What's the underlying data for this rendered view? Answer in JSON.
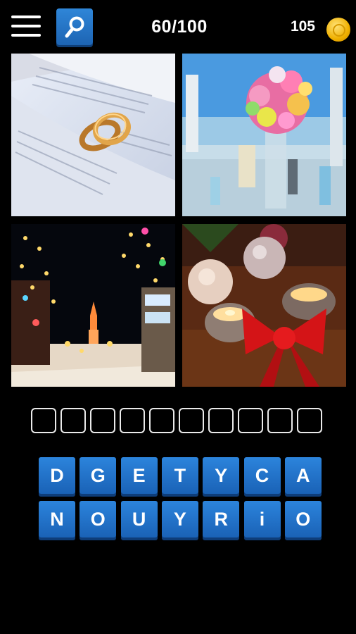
{
  "header": {
    "level_text": "60/100",
    "coins_text": "105",
    "menu_icon": "hamburger-icon",
    "hint_icon": "magnifier-icon",
    "coin_icon": "coin-icon",
    "accent_color": "#1f6fc8",
    "coin_color": "#f5b800"
  },
  "puzzle": {
    "pictures": [
      {
        "id": "picture-1",
        "subject": "wedding rings on open book"
      },
      {
        "id": "picture-2",
        "subject": "flower bouquet table decoration"
      },
      {
        "id": "picture-3",
        "subject": "town street with holiday lights"
      },
      {
        "id": "picture-4",
        "subject": "candles, ornaments and red bow"
      }
    ],
    "answer_length": 10,
    "letters_row1": [
      "D",
      "G",
      "E",
      "T",
      "Y",
      "C",
      "A"
    ],
    "letters_row2": [
      "N",
      "O",
      "U",
      "Y",
      "R",
      "i",
      "O"
    ]
  }
}
